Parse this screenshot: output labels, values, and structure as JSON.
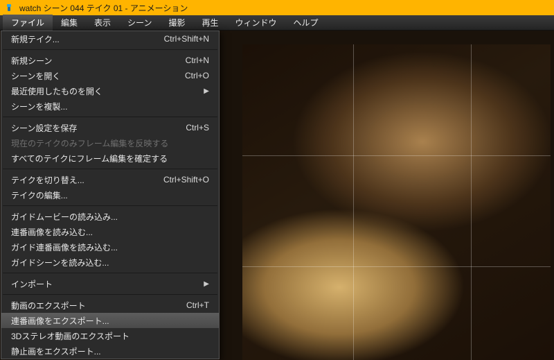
{
  "titlebar": {
    "title": "watch  シーン 044  テイク 01 - アニメーション"
  },
  "menubar": {
    "items": [
      {
        "label": "ファイル",
        "active": true
      },
      {
        "label": "編集"
      },
      {
        "label": "表示"
      },
      {
        "label": "シーン"
      },
      {
        "label": "撮影"
      },
      {
        "label": "再生"
      },
      {
        "label": "ウィンドウ"
      },
      {
        "label": "ヘルプ"
      }
    ]
  },
  "dropdown": {
    "groups": [
      [
        {
          "label": "新規テイク...",
          "shortcut": "Ctrl+Shift+N"
        }
      ],
      [
        {
          "label": "新規シーン",
          "shortcut": "Ctrl+N"
        },
        {
          "label": "シーンを開く",
          "shortcut": "Ctrl+O"
        },
        {
          "label": "最近使用したものを開く",
          "submenu": true
        },
        {
          "label": "シーンを複製..."
        }
      ],
      [
        {
          "label": "シーン設定を保存",
          "shortcut": "Ctrl+S"
        },
        {
          "label": "現在のテイクのみフレーム編集を反映する",
          "disabled": true
        },
        {
          "label": "すべてのテイクにフレーム編集を確定する"
        }
      ],
      [
        {
          "label": "テイクを切り替え...",
          "shortcut": "Ctrl+Shift+O"
        },
        {
          "label": "テイクの編集..."
        }
      ],
      [
        {
          "label": "ガイドムービーの読み込み..."
        },
        {
          "label": "連番画像を読み込む..."
        },
        {
          "label": "ガイド連番画像を読み込む..."
        },
        {
          "label": "ガイドシーンを読み込む..."
        }
      ],
      [
        {
          "label": "インポート",
          "submenu": true
        }
      ],
      [
        {
          "label": "動画のエクスポート",
          "shortcut": "Ctrl+T"
        },
        {
          "label": "連番画像をエクスポート...",
          "hovered": true
        },
        {
          "label": "3Dステレオ動画のエクスポート"
        },
        {
          "label": "静止画をエクスポート..."
        }
      ]
    ]
  }
}
